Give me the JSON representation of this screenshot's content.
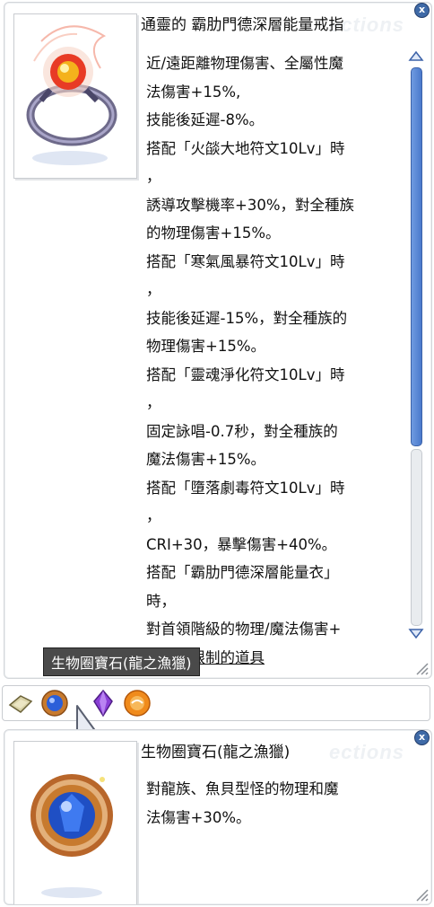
{
  "top_window": {
    "title": "通靈的 霸肋門德深層能量戒指",
    "watermark": "ections",
    "close_label": "x",
    "description_lines": [
      "近/遠距離物理傷害、全屬性魔",
      "法傷害+15%,",
      "技能後延遲-8%。",
      "搭配「火燄大地符文10Lv」時",
      "，",
      "誘導攻擊機率+30%，對全種族",
      "的物理傷害+15%。",
      "搭配「寒氣風暴符文10Lv」時",
      "，",
      "技能後延遲-15%，對全種族的",
      "物理傷害+15%。",
      "搭配「靈魂淨化符文10Lv」時",
      "，",
      "固定詠唱-0.7秒，對全種族的",
      "魔法傷害+15%。",
      "搭配「墮落劇毒符文10Lv」時",
      "，",
      "CRI+30，暴擊傷害+40%。",
      "搭配「霸肋門德深層能量衣」",
      "時，",
      "對首領階級的物理/魔法傷害+",
      "受轉移限制的道具"
    ]
  },
  "tooltip": {
    "text": "生物圈寶石(龍之漁獵)"
  },
  "card_bar": {
    "slots": [
      "ring-icon",
      "blue-gem-icon",
      "purple-crystal-icon",
      "orange-orb-icon"
    ]
  },
  "bottom_window": {
    "title": "生物圈寶石(龍之漁獵)",
    "watermark": "ections",
    "close_label": "x",
    "description_lines": [
      "對龍族、魚貝型怪的物理和魔",
      "法傷害+30%。"
    ]
  },
  "colors": {
    "scroll_thumb": "#4a79cc",
    "tooltip_bg": "#4a4a4a",
    "close_button": "#3f6aa7"
  }
}
